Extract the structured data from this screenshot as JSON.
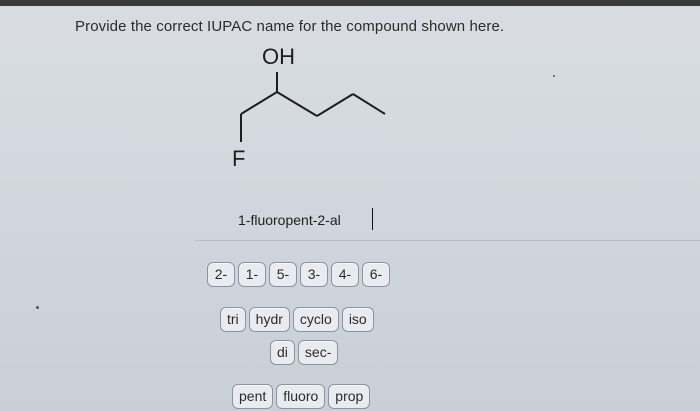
{
  "question": {
    "text": "Provide the correct IUPAC name for the compound shown here."
  },
  "molecule": {
    "oh_label": "OH",
    "f_label": "F"
  },
  "answer": {
    "value": "1-fluoropent-2-al"
  },
  "tiles": {
    "numbers": [
      "2-",
      "1-",
      "5-",
      "3-",
      "4-",
      "6-"
    ],
    "prefixes": [
      "tri",
      "hydr",
      "cyclo",
      "iso"
    ],
    "multipliers": [
      "di",
      "sec-"
    ],
    "roots": [
      "pent",
      "fluoro",
      "prop"
    ]
  }
}
